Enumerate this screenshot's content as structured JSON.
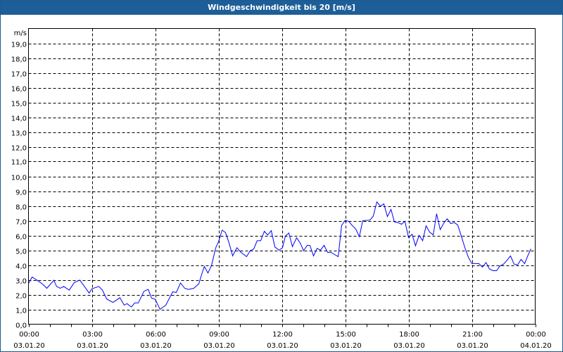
{
  "title": "Windgeschwindigkeit bis 20 [m/s]",
  "chart_data": {
    "type": "line",
    "title": "Windgeschwindigkeit bis 20 [m/s]",
    "ylabel": "m/s",
    "xlabel": "",
    "ylim": [
      0,
      20
    ],
    "xlim_hours": [
      0,
      24
    ],
    "grid": true,
    "line_color": "#0000ff",
    "y_ticks": [
      "0,0",
      "1,0",
      "2,0",
      "3,0",
      "4,0",
      "5,0",
      "6,0",
      "7,0",
      "8,0",
      "9,0",
      "10,0",
      "11,0",
      "12,0",
      "13,0",
      "14,0",
      "15,0",
      "16,0",
      "17,0",
      "18,0",
      "19,0"
    ],
    "x_ticks": [
      {
        "time": "00:00",
        "date": "03.01.20"
      },
      {
        "time": "03:00",
        "date": "03.01.20"
      },
      {
        "time": "06:00",
        "date": "03.01.20"
      },
      {
        "time": "09:00",
        "date": "03.01.20"
      },
      {
        "time": "12:00",
        "date": "03.01.20"
      },
      {
        "time": "15:00",
        "date": "03.01.20"
      },
      {
        "time": "18:00",
        "date": "03.01.20"
      },
      {
        "time": "21:00",
        "date": "03.01.20"
      },
      {
        "time": "00:00",
        "date": "04.01.20"
      }
    ],
    "series": [
      {
        "name": "Windgeschwindigkeit",
        "points_hours_value": [
          [
            0.02,
            2.79
          ],
          [
            0.17,
            3.19
          ],
          [
            0.43,
            2.95
          ],
          [
            0.67,
            2.71
          ],
          [
            0.87,
            2.43
          ],
          [
            1.2,
            2.97
          ],
          [
            1.33,
            2.55
          ],
          [
            1.5,
            2.43
          ],
          [
            1.67,
            2.55
          ],
          [
            1.93,
            2.31
          ],
          [
            2.17,
            2.82
          ],
          [
            2.43,
            2.98
          ],
          [
            2.73,
            2.39
          ],
          [
            2.87,
            2.11
          ],
          [
            3.0,
            2.39
          ],
          [
            3.33,
            2.55
          ],
          [
            3.5,
            2.31
          ],
          [
            3.7,
            1.71
          ],
          [
            4.0,
            1.47
          ],
          [
            4.33,
            1.79
          ],
          [
            4.53,
            1.29
          ],
          [
            4.67,
            1.39
          ],
          [
            4.87,
            1.16
          ],
          [
            5.03,
            1.44
          ],
          [
            5.2,
            1.44
          ],
          [
            5.47,
            2.23
          ],
          [
            5.67,
            2.35
          ],
          [
            5.83,
            1.76
          ],
          [
            6.0,
            1.68
          ],
          [
            6.23,
            1.01
          ],
          [
            6.5,
            1.28
          ],
          [
            6.83,
            2.19
          ],
          [
            7.0,
            2.15
          ],
          [
            7.2,
            2.79
          ],
          [
            7.4,
            2.43
          ],
          [
            7.57,
            2.35
          ],
          [
            7.83,
            2.43
          ],
          [
            8.07,
            2.74
          ],
          [
            8.23,
            3.5
          ],
          [
            8.33,
            3.9
          ],
          [
            8.5,
            3.46
          ],
          [
            8.67,
            3.98
          ],
          [
            8.87,
            5.17
          ],
          [
            9.0,
            5.57
          ],
          [
            9.17,
            6.36
          ],
          [
            9.33,
            6.2
          ],
          [
            9.5,
            5.49
          ],
          [
            9.67,
            4.62
          ],
          [
            9.87,
            5.17
          ],
          [
            10.07,
            4.85
          ],
          [
            10.33,
            4.57
          ],
          [
            10.5,
            4.97
          ],
          [
            10.67,
            5.09
          ],
          [
            10.83,
            5.65
          ],
          [
            11.0,
            5.65
          ],
          [
            11.17,
            6.28
          ],
          [
            11.33,
            6.04
          ],
          [
            11.5,
            6.33
          ],
          [
            11.67,
            5.22
          ],
          [
            11.87,
            5.01
          ],
          [
            12.03,
            5.17
          ],
          [
            12.17,
            5.96
          ],
          [
            12.33,
            6.17
          ],
          [
            12.5,
            5.25
          ],
          [
            12.7,
            5.84
          ],
          [
            12.87,
            5.49
          ],
          [
            13.03,
            4.97
          ],
          [
            13.2,
            5.33
          ],
          [
            13.33,
            5.33
          ],
          [
            13.5,
            4.62
          ],
          [
            13.67,
            5.13
          ],
          [
            13.83,
            5.01
          ],
          [
            14.0,
            5.33
          ],
          [
            14.17,
            4.85
          ],
          [
            14.33,
            4.85
          ],
          [
            14.67,
            4.57
          ],
          [
            14.83,
            6.68
          ],
          [
            15.0,
            7.03
          ],
          [
            15.17,
            6.95
          ],
          [
            15.33,
            6.68
          ],
          [
            15.5,
            6.44
          ],
          [
            15.67,
            5.92
          ],
          [
            15.83,
            7.0
          ],
          [
            16.17,
            7.04
          ],
          [
            16.33,
            7.31
          ],
          [
            16.5,
            8.27
          ],
          [
            16.67,
            7.98
          ],
          [
            16.83,
            8.14
          ],
          [
            17.0,
            7.28
          ],
          [
            17.17,
            7.76
          ],
          [
            17.33,
            6.92
          ],
          [
            17.5,
            6.87
          ],
          [
            17.67,
            6.76
          ],
          [
            17.83,
            6.96
          ],
          [
            18.0,
            5.86
          ],
          [
            18.17,
            6.08
          ],
          [
            18.33,
            5.3
          ],
          [
            18.5,
            6.01
          ],
          [
            18.67,
            5.65
          ],
          [
            18.83,
            6.65
          ],
          [
            19.0,
            6.23
          ],
          [
            19.17,
            6.04
          ],
          [
            19.33,
            7.47
          ],
          [
            19.5,
            6.4
          ],
          [
            19.67,
            6.84
          ],
          [
            19.83,
            7.13
          ],
          [
            20.0,
            6.81
          ],
          [
            20.17,
            6.87
          ],
          [
            20.33,
            6.71
          ],
          [
            20.5,
            5.96
          ],
          [
            20.67,
            5.17
          ],
          [
            20.83,
            4.54
          ],
          [
            21.0,
            4.1
          ],
          [
            21.33,
            4.1
          ],
          [
            21.5,
            3.86
          ],
          [
            21.67,
            4.17
          ],
          [
            21.83,
            3.74
          ],
          [
            22.0,
            3.62
          ],
          [
            22.17,
            3.62
          ],
          [
            22.33,
            3.94
          ],
          [
            22.5,
            4.06
          ],
          [
            22.67,
            4.33
          ],
          [
            22.83,
            4.62
          ],
          [
            23.0,
            4.06
          ],
          [
            23.17,
            4.02
          ],
          [
            23.33,
            4.38
          ],
          [
            23.5,
            4.1
          ],
          [
            23.67,
            4.7
          ],
          [
            23.8,
            5.1
          ]
        ]
      }
    ]
  }
}
